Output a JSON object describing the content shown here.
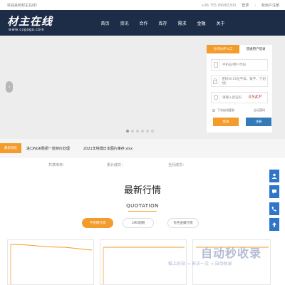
{
  "topbar": {
    "welcome": "欢迎来到材主在线！",
    "phone": "+86 755 89982300",
    "login": "登录",
    "register": "新用户注册"
  },
  "logo": {
    "cn": "材主在线",
    "en": "www.czgogo.com"
  },
  "nav": {
    "items": [
      "首页",
      "资讯",
      "合作",
      "库存",
      "需求",
      "金融",
      "关于"
    ]
  },
  "login_panel": {
    "tab_active": "合作伙伴入口",
    "tab_inactive": "普通用户登录",
    "username_placeholder": "手机号/用户代码",
    "password_placeholder": "密码(8-20位字母、数字、下划线)",
    "captcha_placeholder": "请输入验证码",
    "captcha_text": "6SKP",
    "remember": "下次自动登录",
    "forgot": "忘记密码",
    "login_btn": "登录",
    "register_btn": "注册"
  },
  "ticker": {
    "label": "最新消息",
    "items": [
      "进口NGK贱铜一批特价处理",
      "2021年特價日本图片庫存.xlsx"
    ]
  },
  "stats": [
    "共享库存：",
    "累计成交：",
    "当月成交："
  ],
  "section": {
    "title": "最新行情",
    "subtitle": "QUOTATION",
    "tabs": [
      "不锈钢行情",
      "LME期期",
      "有色金属行情"
    ]
  },
  "colors": {
    "accent": "#f39c2c",
    "nav_bg": "#1d2c47",
    "blue": "#2f76c9"
  },
  "float_icons": [
    "user-icon",
    "chat-icon",
    "phone-icon",
    "arrow-up-icon"
  ],
  "watermark": {
    "big": "自动秒收录",
    "small": "做上好站 → 来访一次 → 自动收录"
  }
}
